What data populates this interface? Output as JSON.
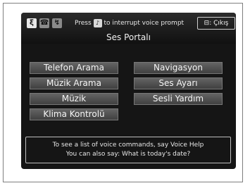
{
  "status": {
    "prompt_pre": "Press",
    "prompt_post": "to interrupt voice prompt",
    "exit_label": ": Çıkış"
  },
  "title": "Ses Portalı",
  "menu": {
    "telefon": "Telefon Arama",
    "navigasyon": "Navigasyon",
    "muzik_arama": "Müzik Arama",
    "ses_ayari": "Ses Ayarı",
    "muzik": "Müzik",
    "sesli_yardim": "Sesli Yardım",
    "klima": "Klima Kontrolü"
  },
  "help": {
    "line1": "To see a list of voice commands, say Voice Help",
    "line2": "You can also say: What is today's date?"
  },
  "icons": [
    "voice-status-icon",
    "phone-status-icon",
    "signal-status-icon",
    "talk-button-icon",
    "back-button-icon"
  ]
}
